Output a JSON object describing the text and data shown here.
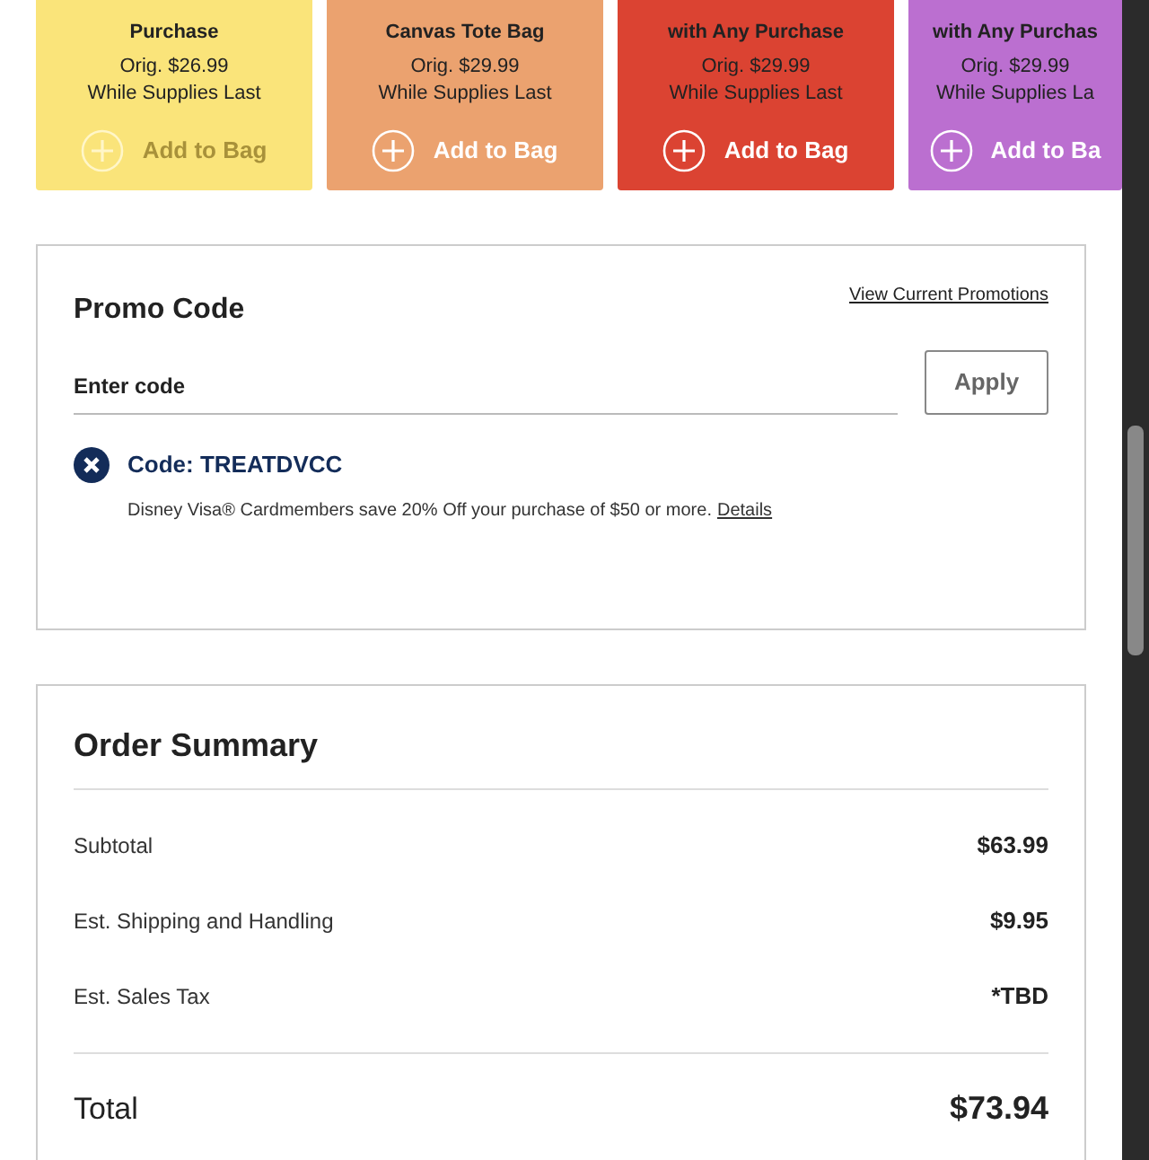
{
  "offers": [
    {
      "title_lines": [
        "Purchase"
      ],
      "price": "Orig. $26.99",
      "note": "While Supplies Last",
      "button": "Add to Bag",
      "color": "#fae47a",
      "disabled": true
    },
    {
      "title_lines": [
        "Canvas Tote Bag"
      ],
      "price": "Orig. $29.99",
      "note": "While Supplies Last",
      "button": "Add to Bag",
      "color": "#eba26f",
      "disabled": false
    },
    {
      "title_lines": [
        "with Any Purchase"
      ],
      "price": "Orig. $29.99",
      "note": "While Supplies Last",
      "button": "Add to Bag",
      "color": "#db4332",
      "disabled": false
    },
    {
      "title_lines": [
        "with Any Purchas"
      ],
      "price": "Orig. $29.99",
      "note": "While Supplies La",
      "button": "Add to Ba",
      "color": "#bb6fd0",
      "disabled": false
    }
  ],
  "promo": {
    "title": "Promo Code",
    "link": "View Current Promotions",
    "placeholder": "Enter code",
    "apply": "Apply",
    "code": "Code: TREATDVCC",
    "description": "Disney Visa® Cardmembers save 20% Off your purchase of $50 or more.",
    "details": "Details"
  },
  "summary": {
    "title": "Order Summary",
    "rows": [
      {
        "label": "Subtotal",
        "value": "$63.99"
      },
      {
        "label": "Est. Shipping and Handling",
        "value": "$9.95"
      },
      {
        "label": "Est. Sales Tax",
        "value": "*TBD"
      }
    ],
    "total_label": "Total",
    "total_value": "$73.94"
  }
}
